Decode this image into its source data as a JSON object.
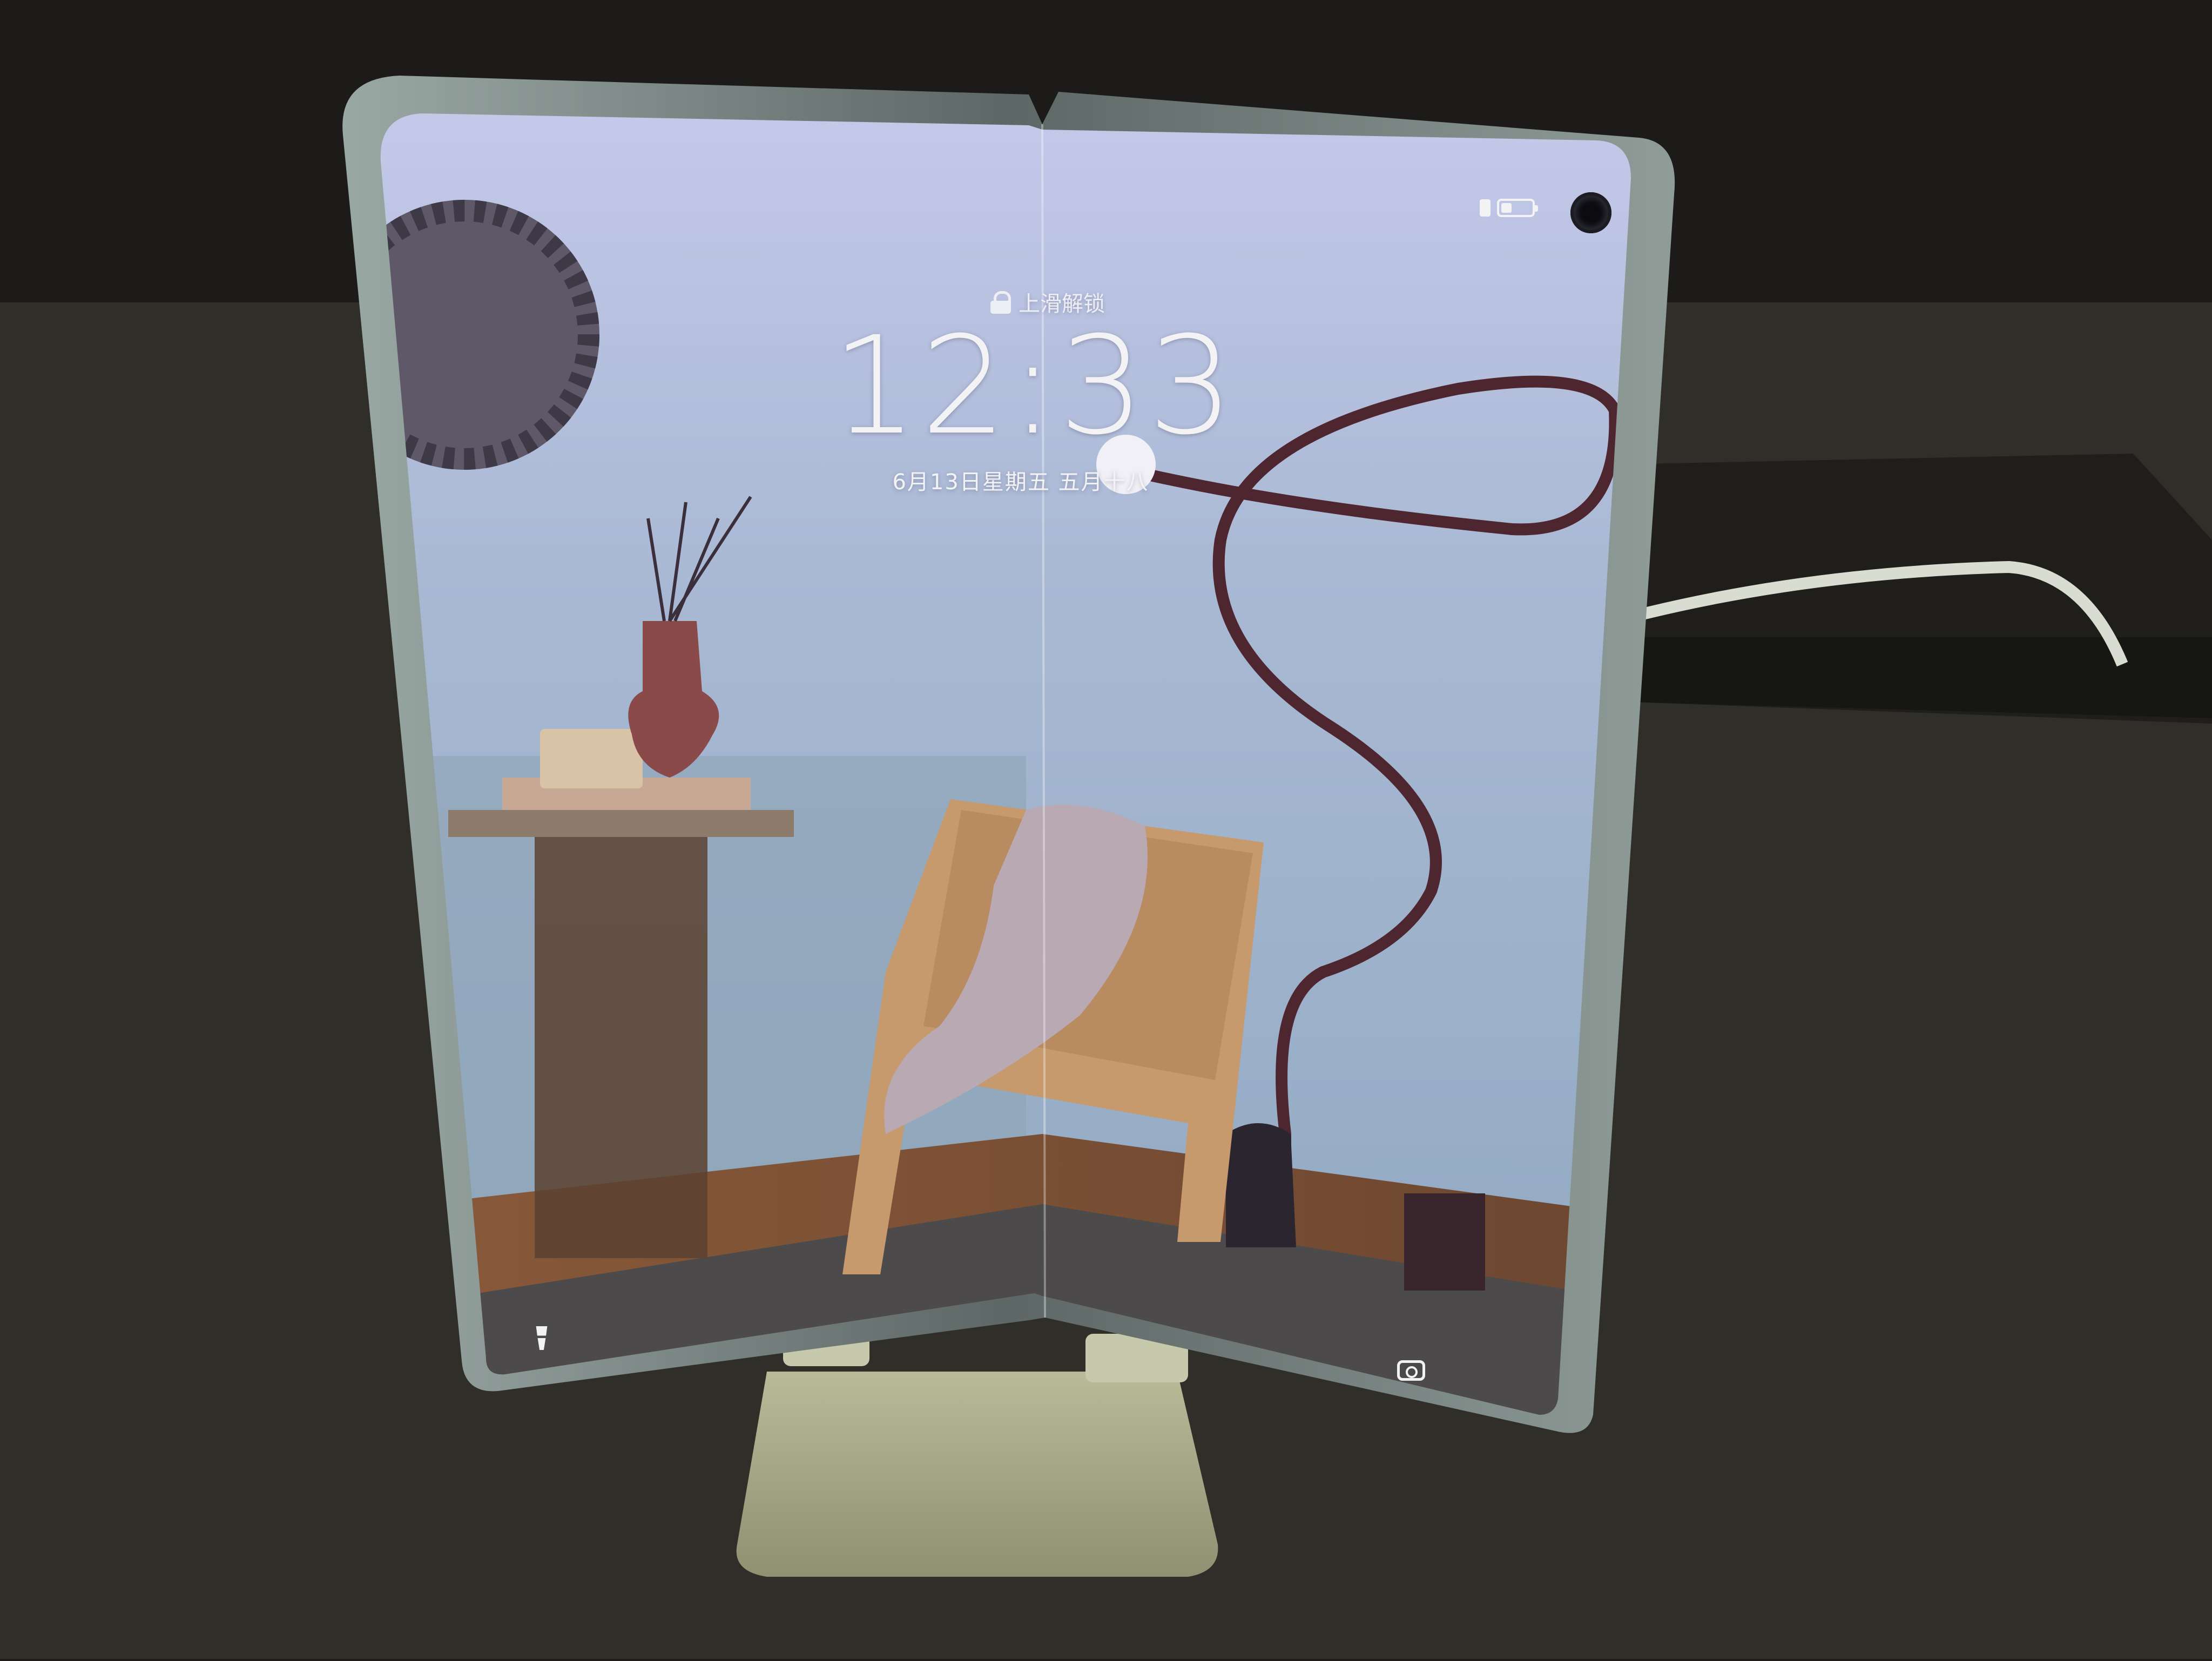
{
  "lockscreen": {
    "unlock_hint": "上滑解锁",
    "time": "12:33",
    "date": "6月13日星期五  五月十八",
    "battery_fraction": 0.35,
    "shortcut_left_icon": "flashlight-icon",
    "shortcut_right_icon": "camera-icon"
  },
  "colors": {
    "wall": "#9eb2c9",
    "screen_tint": "#c7cbe8",
    "stand": "#9da07f",
    "desk": "#2e2d28"
  }
}
